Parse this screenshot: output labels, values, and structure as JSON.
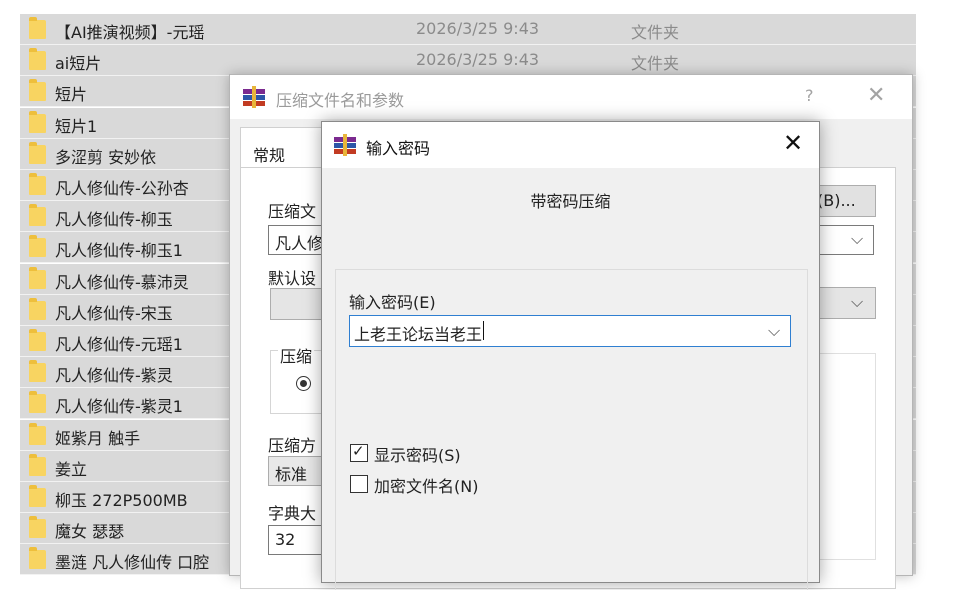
{
  "explorer": {
    "rows": [
      {
        "name": "【AI推演视频】-元瑶",
        "date": "2026/3/25 9:43",
        "type": "文件夹"
      },
      {
        "name": "ai短片",
        "date": "2026/3/25 9:43",
        "type": "文件夹"
      },
      {
        "name": "短片",
        "date": "",
        "type": ""
      },
      {
        "name": "短片1",
        "date": "",
        "type": ""
      },
      {
        "name": "多涩剪 安妙依",
        "date": "",
        "type": ""
      },
      {
        "name": "凡人修仙传-公孙杏",
        "date": "",
        "type": ""
      },
      {
        "name": "凡人修仙传-柳玉",
        "date": "",
        "type": ""
      },
      {
        "name": "凡人修仙传-柳玉1",
        "date": "",
        "type": ""
      },
      {
        "name": "凡人修仙传-慕沛灵",
        "date": "",
        "type": ""
      },
      {
        "name": "凡人修仙传-宋玉",
        "date": "",
        "type": ""
      },
      {
        "name": "凡人修仙传-元瑶1",
        "date": "",
        "type": ""
      },
      {
        "name": "凡人修仙传-紫灵",
        "date": "",
        "type": ""
      },
      {
        "name": "凡人修仙传-紫灵1",
        "date": "",
        "type": ""
      },
      {
        "name": "姬紫月 触手",
        "date": "",
        "type": ""
      },
      {
        "name": "姜立",
        "date": "",
        "type": ""
      },
      {
        "name": "柳玉  272P500MB",
        "date": "",
        "type": ""
      },
      {
        "name": "魔女 瑟瑟",
        "date": "",
        "type": ""
      },
      {
        "name": "墨涟 凡人修仙传 口腔",
        "date": "",
        "type": ""
      }
    ]
  },
  "archive_dialog": {
    "title": "压缩文件名和参数",
    "help": "?",
    "close": "✕",
    "tab_general": "常规",
    "label_archive_name": "压缩文",
    "archive_name_value": "凡人修",
    "browse_button": "(B)...",
    "label_profile": "默认设",
    "label_format": "压缩",
    "label_method": "压缩方",
    "method_value": "标准",
    "label_dictionary": "字典大",
    "dictionary_value": "32"
  },
  "password_dialog": {
    "title": "输入密码",
    "close": "✕",
    "heading": "带密码压缩",
    "input_label": "输入密码(E)",
    "input_value": "上老王论坛当老王",
    "show_password": {
      "label": "显示密码(S)",
      "checked": true
    },
    "encrypt_names": {
      "label": "加密文件名(N)",
      "checked": false
    }
  }
}
